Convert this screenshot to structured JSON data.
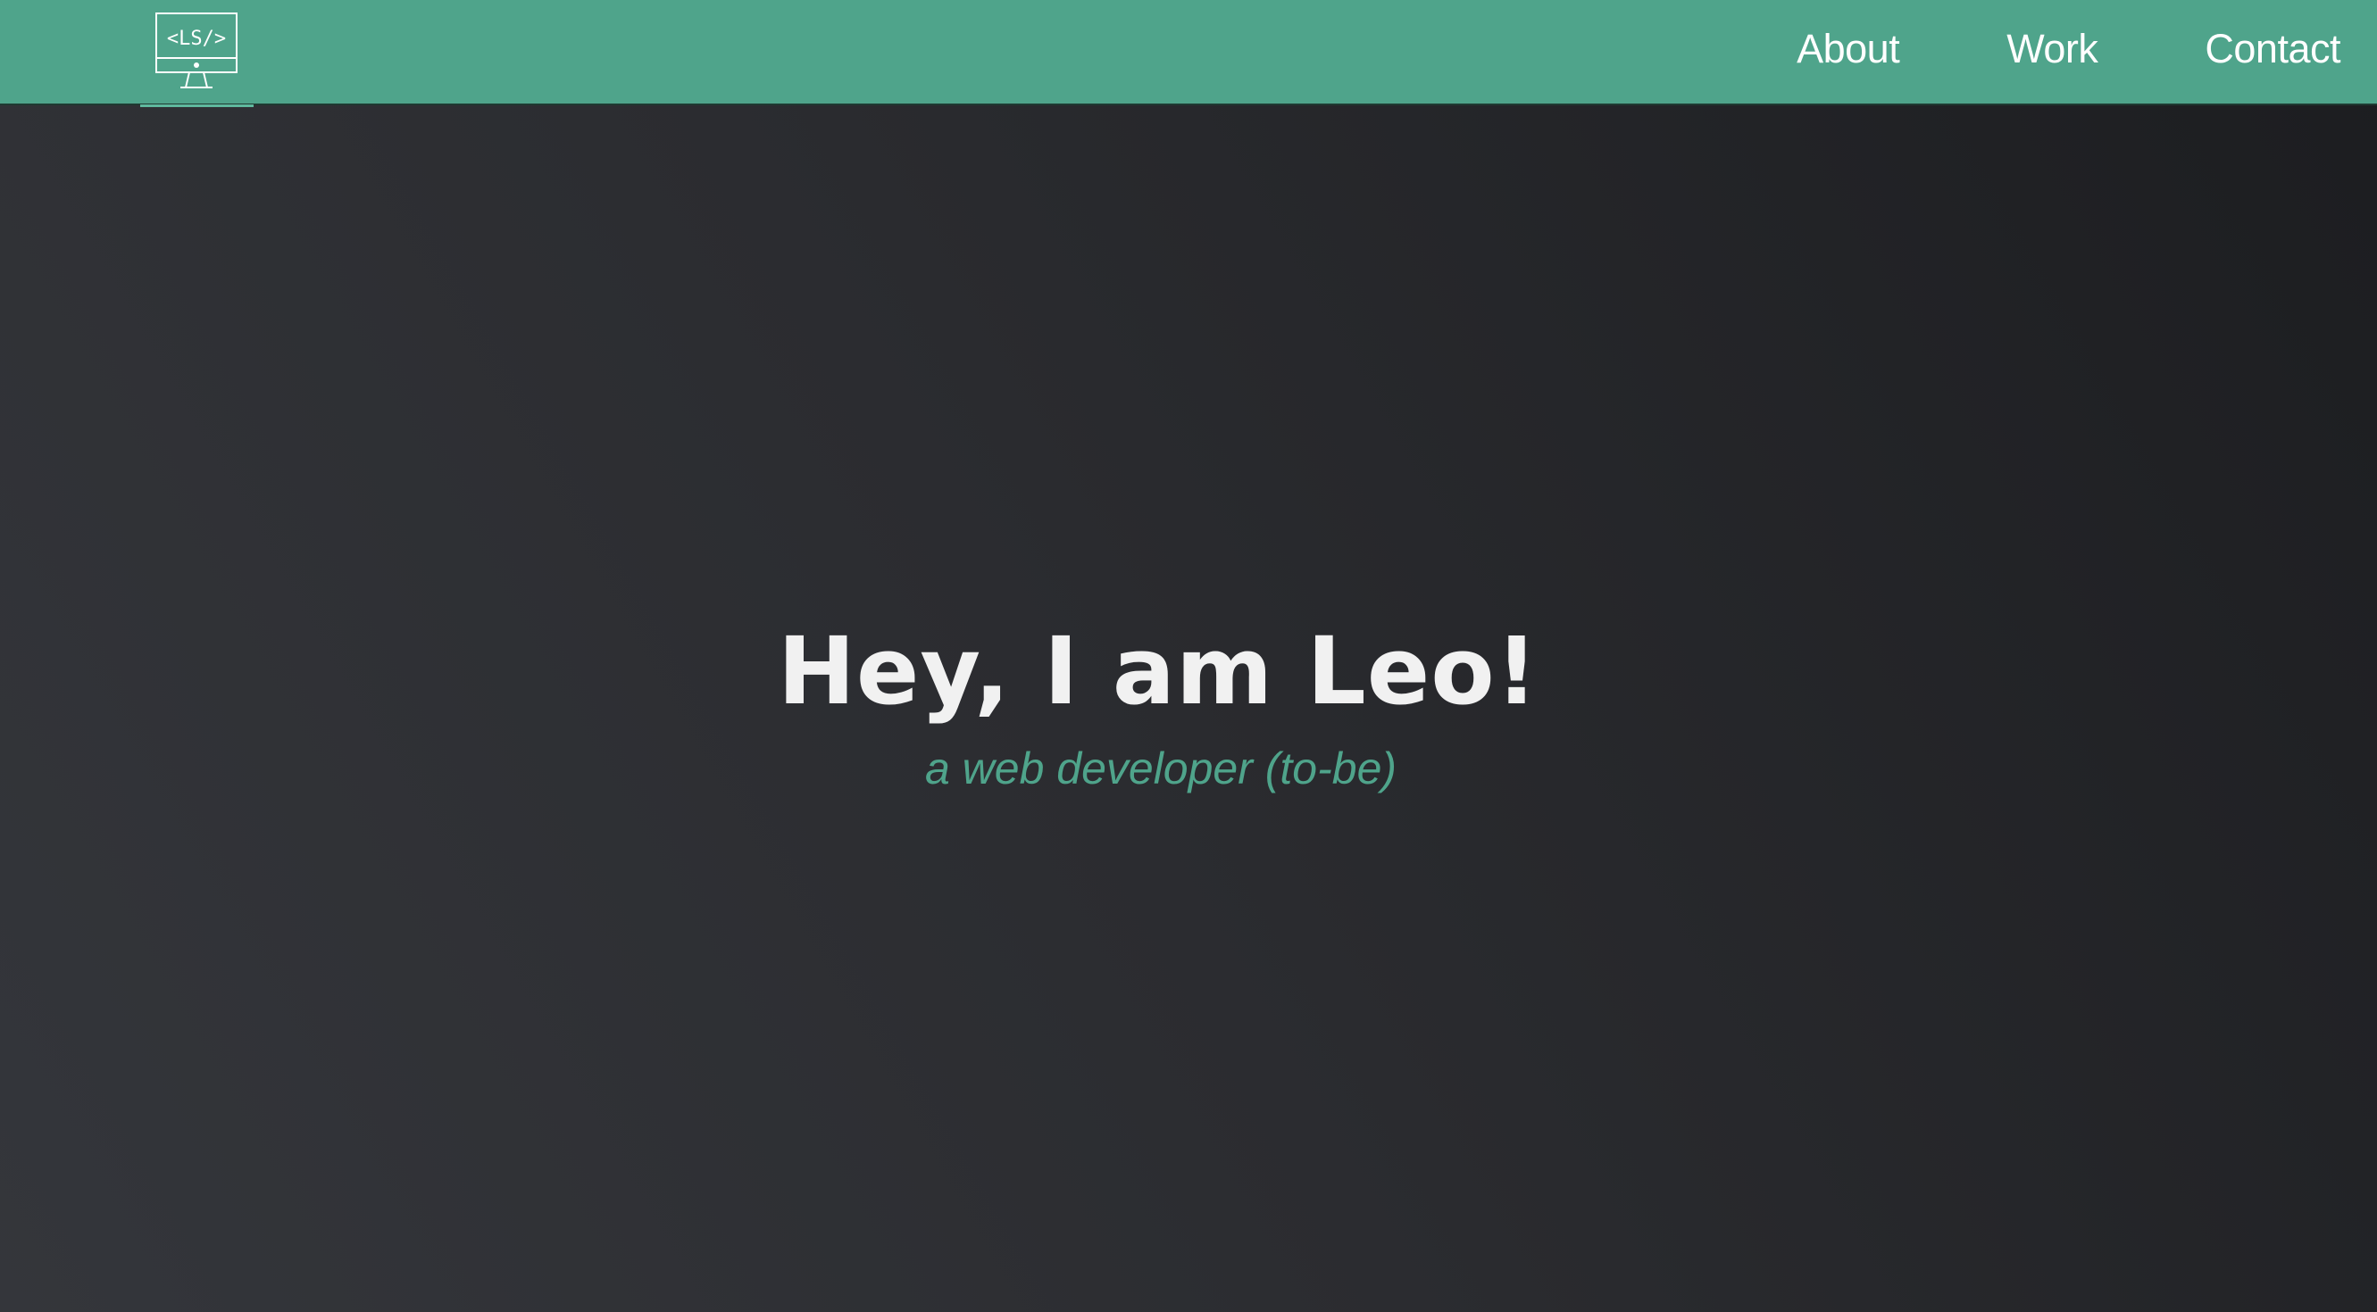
{
  "navbar": {
    "logo_text": "<LS/>",
    "links": [
      {
        "label": "About"
      },
      {
        "label": "Work"
      },
      {
        "label": "Contact"
      }
    ]
  },
  "hero": {
    "title": "Hey, I am Leo!",
    "subtitle": "a web developer (to-be)"
  },
  "colors": {
    "accent": "#4fa48b",
    "background_light": "#34363b",
    "background_dark": "#1c1d20",
    "title_text": "#f1f1f1"
  },
  "icons": {
    "logo": "monitor-icon"
  }
}
